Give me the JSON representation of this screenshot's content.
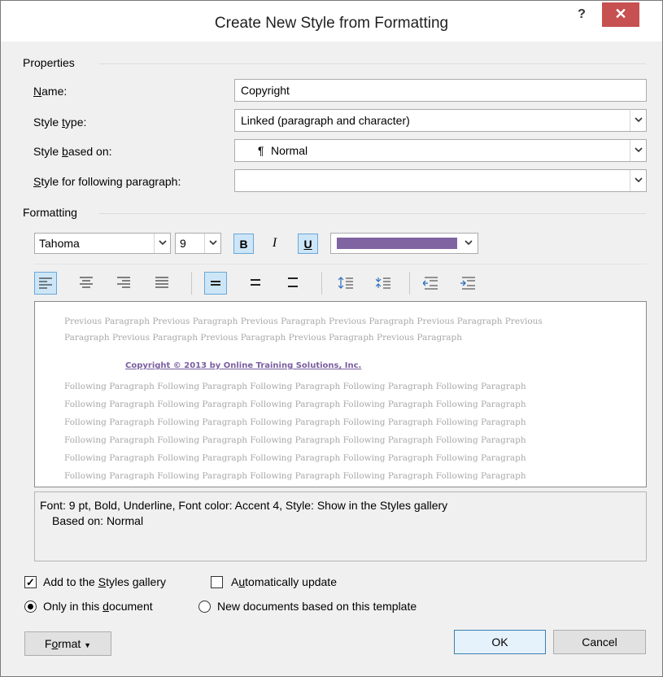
{
  "dialog": {
    "title": "Create New Style from Formatting",
    "help": "?",
    "close": "✕"
  },
  "properties": {
    "section": "Properties",
    "name_label": "Name:",
    "name_value": "Copyright",
    "style_type_label": "Style type:",
    "style_type_value": "Linked (paragraph and character)",
    "based_on_label": "Style based on:",
    "based_on_value": "Normal",
    "based_on_icon": "pilcrow-icon",
    "following_label": "Style for following paragraph:",
    "following_value": ""
  },
  "formatting": {
    "section": "Formatting",
    "font": "Tahoma",
    "size": "9",
    "bold": "B",
    "italic": "I",
    "underline": "U",
    "font_color": "#8064a2"
  },
  "preview": {
    "previous_lines": [
      "Previous Paragraph Previous Paragraph Previous Paragraph Previous Paragraph Previous Paragraph Previous",
      "Paragraph Previous Paragraph Previous Paragraph Previous Paragraph Previous Paragraph"
    ],
    "sample": "Copyright © 2013 by Online Training Solutions, Inc.",
    "following_line": "Following Paragraph Following Paragraph Following Paragraph Following Paragraph Following Paragraph"
  },
  "description": {
    "line1": "Font: 9 pt, Bold, Underline, Font color: Accent 4, Style: Show in the Styles gallery",
    "line2": "Based on: Normal"
  },
  "options": {
    "add_gallery": "Add to the Styles gallery",
    "add_gallery_checked": true,
    "auto_update": "Automatically update",
    "auto_update_checked": false,
    "only_doc": "Only in this document",
    "new_docs": "New documents based on this template"
  },
  "buttons": {
    "format": "Format",
    "ok": "OK",
    "cancel": "Cancel"
  }
}
